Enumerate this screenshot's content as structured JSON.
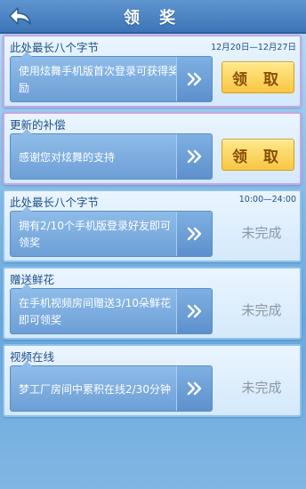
{
  "header": {
    "title": "领 奖",
    "back_icon": "back-arrow-icon"
  },
  "tasks": [
    {
      "title": "此处最长八个字节",
      "date": "12月20日—12月27日",
      "desc": "使用炫舞手机版首次登录可获得奖励",
      "action": "领 取"
    },
    {
      "title": "更新的补偿",
      "date": "",
      "desc": "感谢您对炫舞的支持",
      "action": "领 取"
    },
    {
      "title": "此处最长八个字节",
      "date": "10:00—24:00",
      "desc": "拥有2/10个手机版登录好友即可领奖",
      "status": "未完成"
    },
    {
      "title": "赠送鲜花",
      "date": "",
      "desc": "在手机视频房间赠送3/10朵鲜花即可领奖",
      "status": "未完成"
    },
    {
      "title": "视频在线",
      "date": "",
      "desc": "梦工厂房间中累积在线2/30分钟",
      "status": "未完成"
    }
  ],
  "colors": {
    "accent": "#f8c644",
    "header": "#3d74b6",
    "card_border_blue": "#8ec2ee",
    "card_border_purple": "#c7a6e6"
  }
}
